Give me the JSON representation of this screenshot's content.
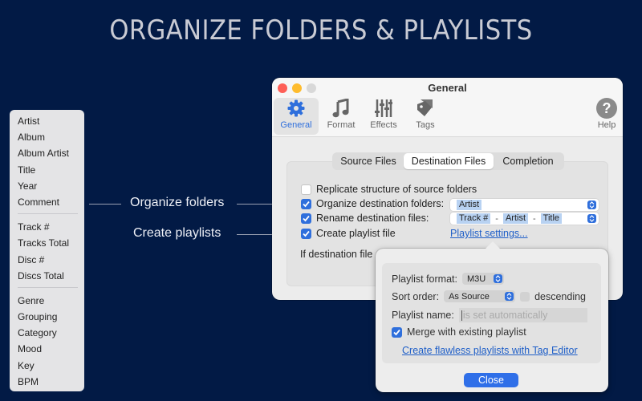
{
  "headline": "ORGANIZE FOLDERS & PLAYLISTS",
  "tag_list": {
    "groups": [
      [
        "Artist",
        "Album",
        "Album Artist",
        "Title",
        "Year",
        "Comment"
      ],
      [
        "Track #",
        "Tracks Total",
        "Disc #",
        "Discs Total"
      ],
      [
        "Genre",
        "Grouping",
        "Category",
        "Mood",
        "Key",
        "BPM"
      ]
    ]
  },
  "callouts": {
    "organize": "Organize folders",
    "playlists": "Create  playlists"
  },
  "window": {
    "title": "General",
    "toolbar": [
      {
        "label": "General",
        "icon": "gear-icon",
        "active": true
      },
      {
        "label": "Format",
        "icon": "music-note-icon",
        "active": false
      },
      {
        "label": "Effects",
        "icon": "equalizer-icon",
        "active": false
      },
      {
        "label": "Tags",
        "icon": "tag-icon",
        "active": false
      },
      {
        "label": "Help",
        "icon": "help-icon",
        "active": false
      }
    ],
    "tabs": [
      {
        "label": "Source Files",
        "active": false
      },
      {
        "label": "Destination Files",
        "active": true
      },
      {
        "label": "Completion",
        "active": false
      }
    ],
    "options": {
      "replicate": {
        "label": "Replicate structure of source folders",
        "checked": false
      },
      "organize": {
        "label": "Organize destination folders:",
        "checked": true,
        "tokens": [
          "Artist"
        ]
      },
      "rename": {
        "label": "Rename destination files:",
        "checked": true,
        "tokens": [
          "Track #",
          "Artist",
          "Title"
        ],
        "separator": "-"
      },
      "playlist": {
        "label": "Create playlist file",
        "checked": true,
        "link": "Playlist settings..."
      },
      "if_exists": "If destination file"
    }
  },
  "popover": {
    "format_label": "Playlist format:",
    "format_value": "M3U",
    "sort_label": "Sort order:",
    "sort_value": "As Source",
    "descending_label": "descending",
    "descending_checked": false,
    "name_label": "Playlist name:",
    "name_placeholder": "is set automatically",
    "merge_label": "Merge with existing playlist",
    "merge_checked": true,
    "tag_editor_link": "Create flawless playlists with Tag Editor",
    "close_label": "Close"
  },
  "colors": {
    "background": "#021a45",
    "accent": "#2f6fdc",
    "link": "#1f5fc8"
  }
}
